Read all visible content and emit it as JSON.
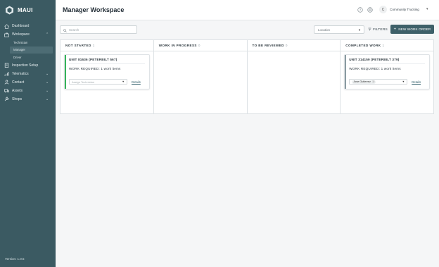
{
  "app": {
    "brand_name": "MAUI",
    "version": "Version: 1.0.5"
  },
  "sidebar": {
    "items": [
      {
        "label": "Dashboard",
        "icon": "home-icon"
      },
      {
        "label": "Workspace",
        "icon": "briefcase-icon",
        "expanded": true
      },
      {
        "label": "Inspection Setup",
        "icon": "clipboard-icon"
      },
      {
        "label": "Telematics",
        "icon": "signal-icon"
      },
      {
        "label": "Contact",
        "icon": "person-icon"
      },
      {
        "label": "Assets",
        "icon": "truck-icon"
      },
      {
        "label": "Shops",
        "icon": "wrench-icon"
      }
    ],
    "workspace_sub": [
      "Technician",
      "Manager",
      "Driver"
    ],
    "active_sub": "Manager"
  },
  "header": {
    "title": "Manager Workspace",
    "avatar_letter": "C",
    "org_name": "Community Trucking"
  },
  "toolbar": {
    "search_placeholder": "Search",
    "location_placeholder": "Location",
    "filters_label": "FILTERS",
    "new_work_order_label": "NEW WORK ORDER"
  },
  "board": {
    "columns": [
      {
        "title": "NOT STARTED",
        "count": "1"
      },
      {
        "title": "WORK IN PROGRESS",
        "count": "0"
      },
      {
        "title": "TO BE REVIEWED",
        "count": "0"
      },
      {
        "title": "COMPLETED WORK",
        "count": "1"
      }
    ],
    "cards": {
      "not_started": {
        "title": "UNIT 81636 (PETERBILT 567)",
        "work_label": "WORK REQUIRED:",
        "work_value": "1 work items",
        "technician_placeholder": "Assign Technician",
        "details_label": "Details",
        "stripe_color": "#34b45a"
      },
      "completed": {
        "title": "UNIT 314159 (PETERBILT 379)",
        "work_label": "WORK REQUIRED:",
        "work_value": "1 work items",
        "technician_chip": "Jose Gutierrez",
        "details_label": "Details",
        "stripe_color": "#8a9ba1"
      }
    }
  },
  "colors": {
    "sidebar_bg": "#3b5a62",
    "primary_button": "#3e6069",
    "accent_green": "#34b45a"
  }
}
